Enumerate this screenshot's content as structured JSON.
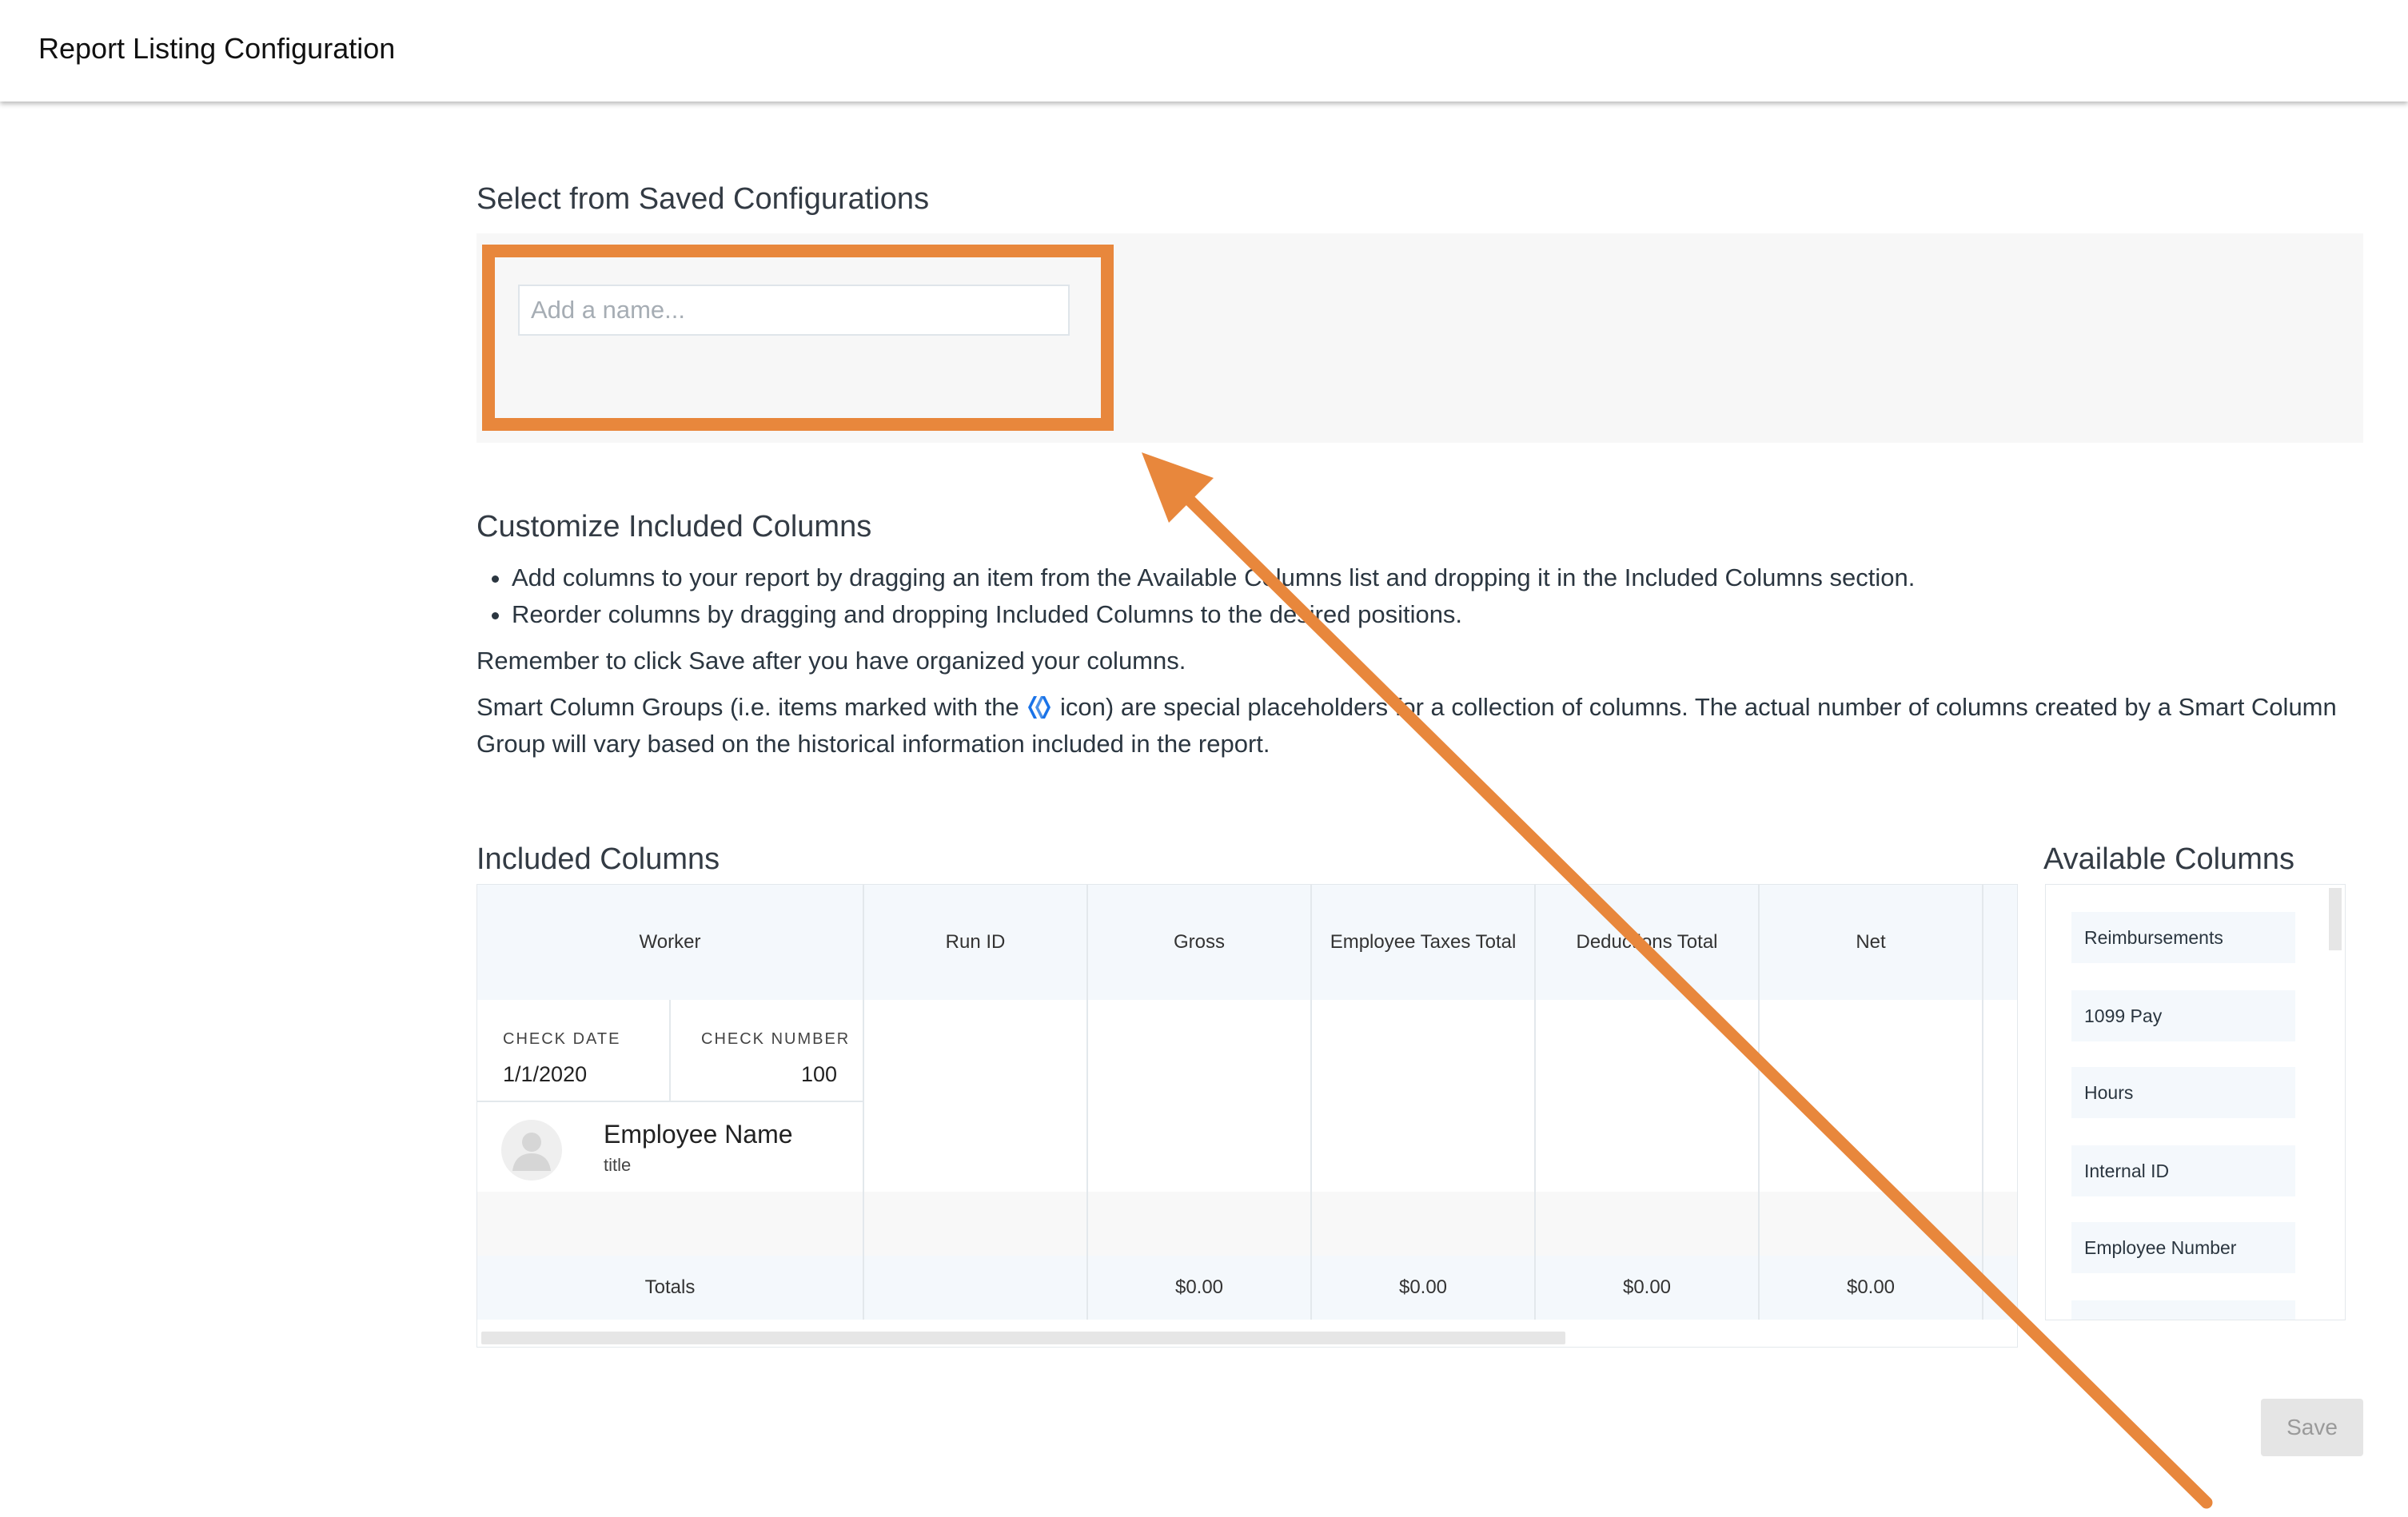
{
  "header": {
    "title": "Report Listing Configuration"
  },
  "saved": {
    "heading": "Select from Saved Configurations",
    "input_placeholder": "Add a name...",
    "input_value": ""
  },
  "customize": {
    "heading": "Customize Included Columns",
    "bullets": [
      "Add columns to your report by dragging an item from the Available Columns list and dropping it in the Included Columns section.",
      "Reorder columns by dragging and dropping Included Columns to the desired positions."
    ],
    "reminder": "Remember to click Save after you have organized your columns.",
    "smart_before": "Smart Column Groups (i.e. items marked with the",
    "smart_after": "icon) are special placeholders for a collection of columns. The actual number of columns created by a Smart Column Group will vary based on the historical information included in the report."
  },
  "included": {
    "heading": "Included Columns",
    "columns": [
      "Worker",
      "Run ID",
      "Gross",
      "Employee Taxes Total",
      "Deductions Total",
      "Net"
    ],
    "worker_cell": {
      "check_date_label": "CHECK DATE",
      "check_date": "1/1/2020",
      "check_number_label": "CHECK NUMBER",
      "check_number": "100",
      "employee_name": "Employee Name",
      "employee_title": "title"
    },
    "totals": [
      "Totals",
      "",
      "$0.00",
      "$0.00",
      "$0.00",
      "$0.00"
    ]
  },
  "available": {
    "heading": "Available Columns",
    "items": [
      "Reimbursements",
      "1099 Pay",
      "Hours",
      "Internal ID",
      "Employee Number"
    ]
  },
  "actions": {
    "save_label": "Save"
  },
  "colors": {
    "annotation": "#e8873c",
    "smart_icon": "#1a73e8"
  }
}
